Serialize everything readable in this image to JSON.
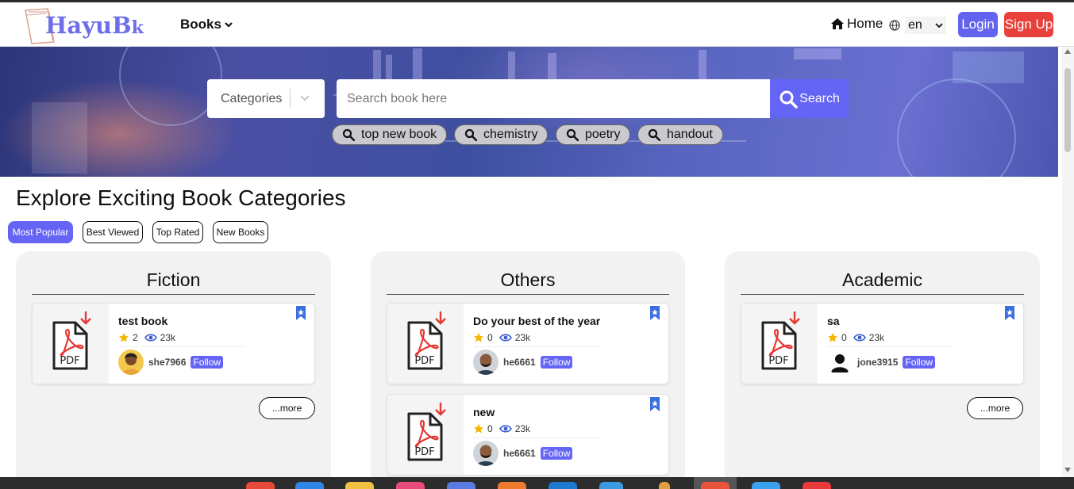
{
  "header": {
    "logo_text": "HayuB",
    "logo_k": "k",
    "books_menu": "Books",
    "home": "Home",
    "language": "en",
    "login": "Login",
    "signup": "Sign Up"
  },
  "search": {
    "category_placeholder": "Categories",
    "placeholder": "Search book here",
    "button": "Search",
    "suggestions": [
      "top new book",
      "chemistry",
      "poetry",
      "handout"
    ]
  },
  "page_title": "Explore Exciting Book Categories",
  "tabs": [
    "Most Popular",
    "Best Viewed",
    "Top Rated",
    "New Books"
  ],
  "active_tab": "Most Popular",
  "categories": [
    {
      "name": "Fiction",
      "more": "...more",
      "books": [
        {
          "title": "test book",
          "rating": "2",
          "views": "23k",
          "author": "she7966",
          "follow": "Follow"
        }
      ]
    },
    {
      "name": "Others",
      "more": "",
      "books": [
        {
          "title": "Do your best of the year",
          "rating": "0",
          "views": "23k",
          "author": "he6661",
          "follow": "Follow"
        },
        {
          "title": "new",
          "rating": "0",
          "views": "23k",
          "author": "he6661",
          "follow": "Follow"
        }
      ]
    },
    {
      "name": "Academic",
      "more": "...more",
      "books": [
        {
          "title": "sa",
          "rating": "0",
          "views": "23k",
          "author": "jone3915",
          "follow": "Follow"
        }
      ]
    }
  ],
  "pdf_label": "PDF",
  "colors": {
    "accent": "#6565f5",
    "signup": "#e8413b",
    "pdf_red": "#e53935",
    "bookmark": "#3b6fe0",
    "star": "#f4b400"
  }
}
